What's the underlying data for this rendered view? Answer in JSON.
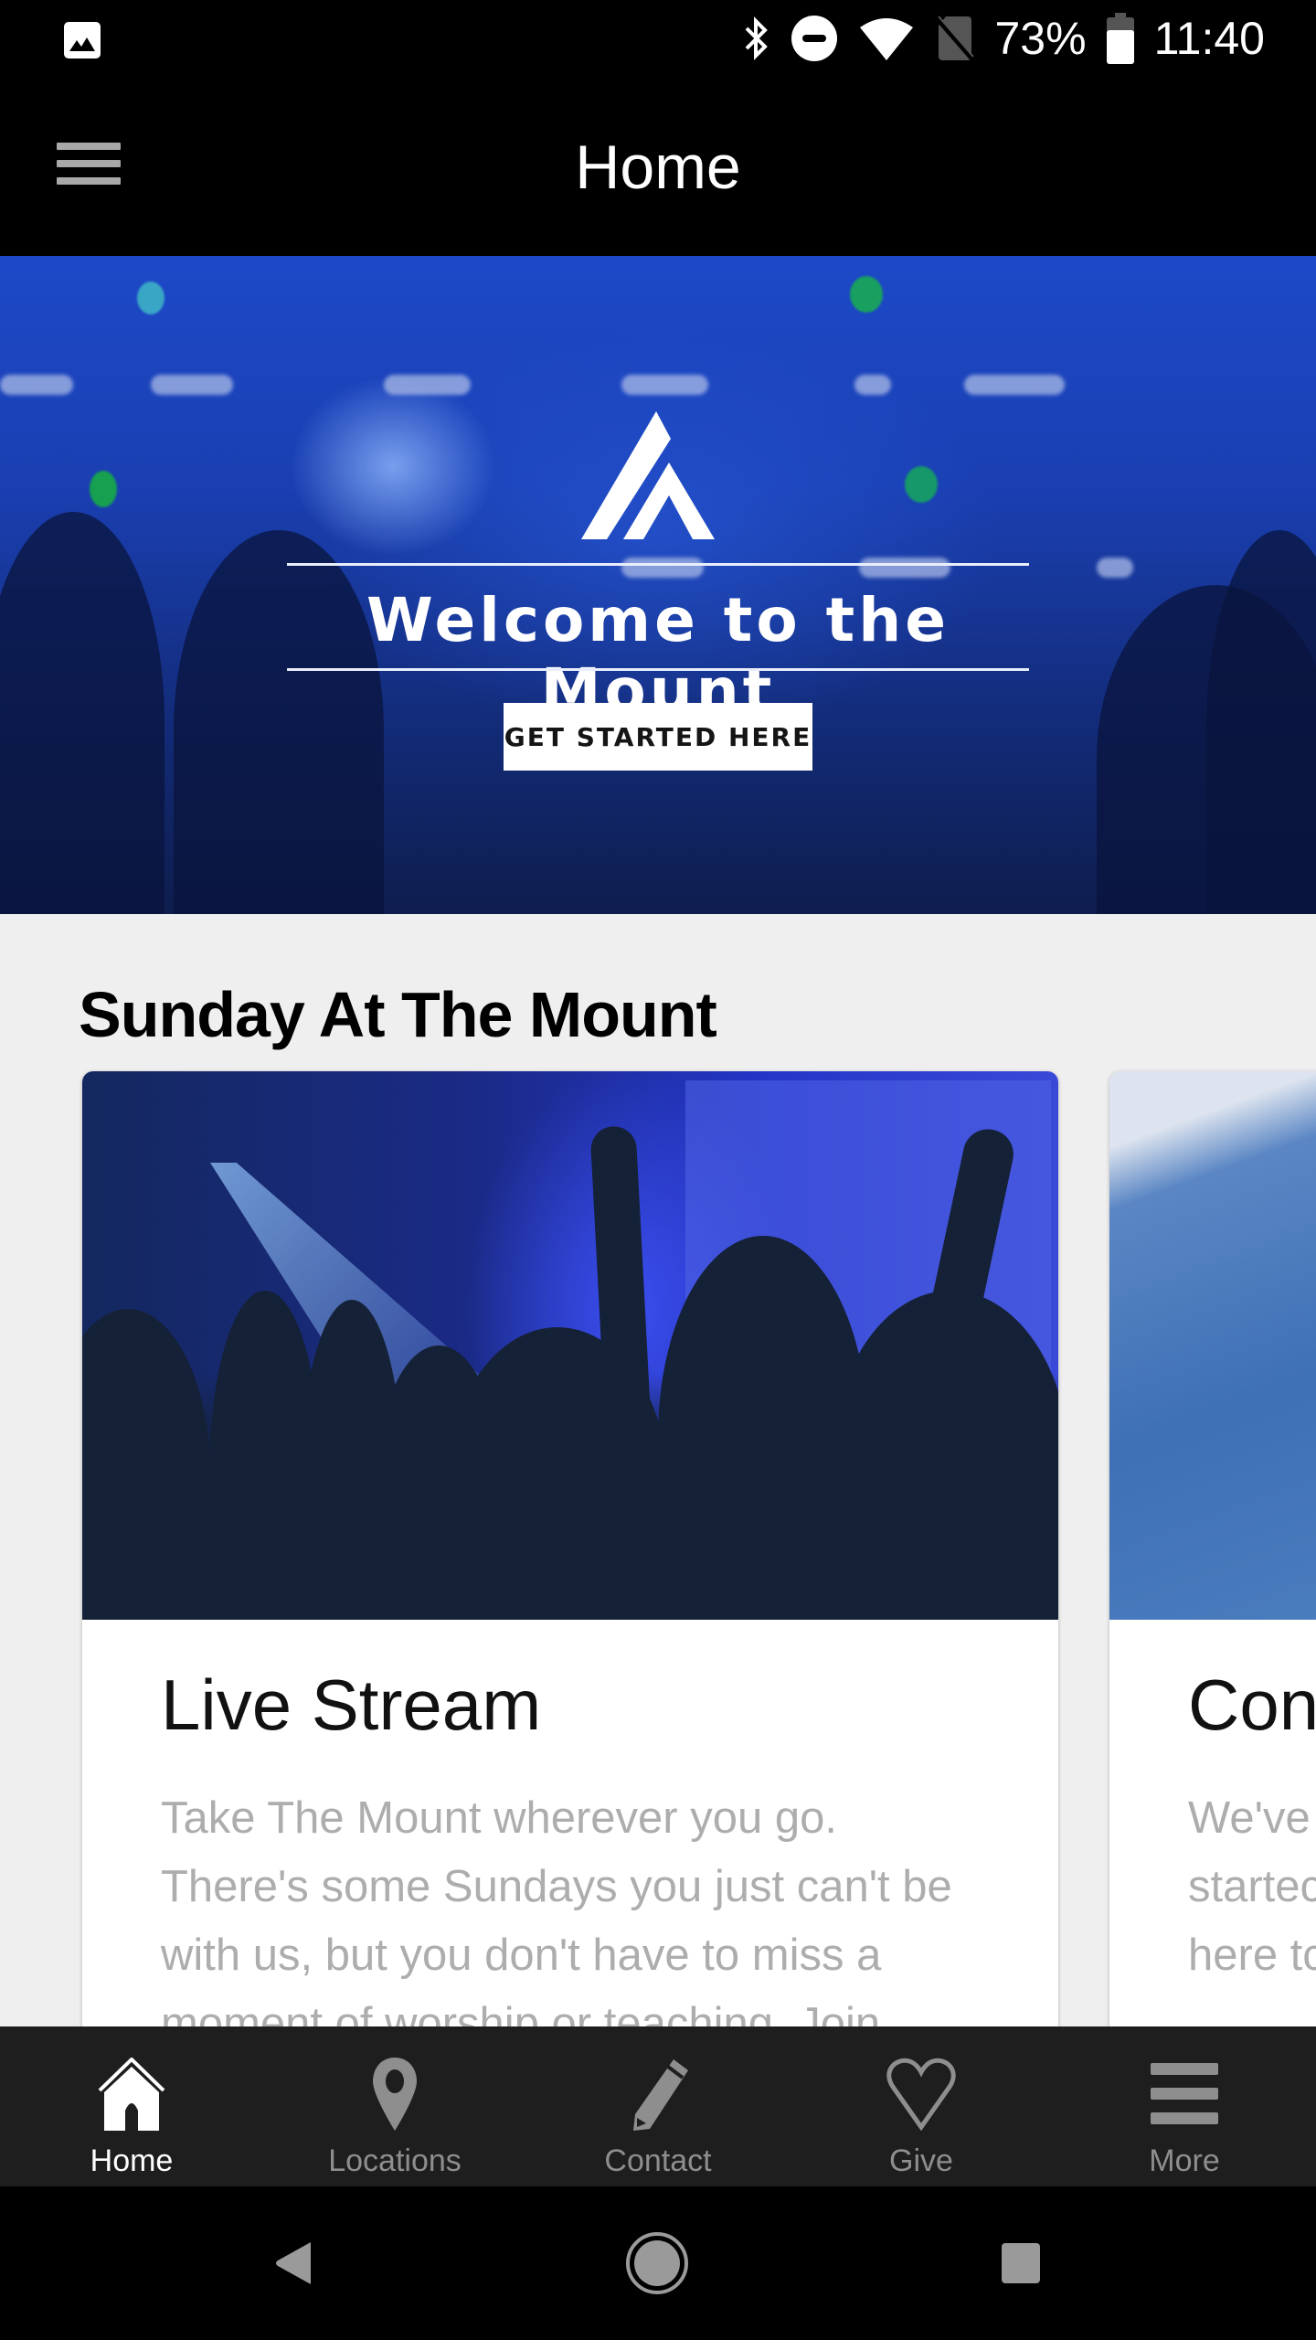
{
  "status_bar": {
    "left_icon": "image-notification-icon",
    "icons": [
      "bluetooth-icon",
      "do-not-disturb-icon",
      "wifi-icon",
      "no-sim-icon",
      "battery-icon"
    ],
    "battery_percent": "73%",
    "battery_level": 0.73,
    "time": "11:40"
  },
  "app_bar": {
    "title": "Home",
    "menu_icon": "hamburger-menu-icon"
  },
  "hero": {
    "logo_icon": "mount-logo-icon",
    "title": "Welcome to the Mount",
    "cta_label": "GET STARTED HERE"
  },
  "section": {
    "title": "Sunday At The Mount",
    "cards": [
      {
        "title": "Live Stream",
        "description": "Take The Mount wherever you go. There's some Sundays you just can't be with us, but you don't have to miss a moment of worship or teaching. Join"
      },
      {
        "title": "Con",
        "description_lines": [
          "We've",
          "startec",
          "here tc"
        ]
      }
    ]
  },
  "tab_bar": {
    "tabs": [
      {
        "label": "Home",
        "icon": "home-icon",
        "active": true
      },
      {
        "label": "Locations",
        "icon": "location-pin-icon",
        "active": false
      },
      {
        "label": "Contact",
        "icon": "pencil-icon",
        "active": false
      },
      {
        "label": "Give",
        "icon": "heart-icon",
        "active": false
      },
      {
        "label": "More",
        "icon": "more-menu-icon",
        "active": false
      }
    ]
  },
  "nav_bar": {
    "buttons": [
      "back-icon",
      "home-circle-icon",
      "recents-icon"
    ]
  },
  "colors": {
    "tab_bar_bg": "#1e1e1e",
    "tab_active": "#ffffff",
    "tab_inactive": "#8e8e8e",
    "page_bg": "#efefef",
    "hero_blue": "#1d49c8"
  }
}
